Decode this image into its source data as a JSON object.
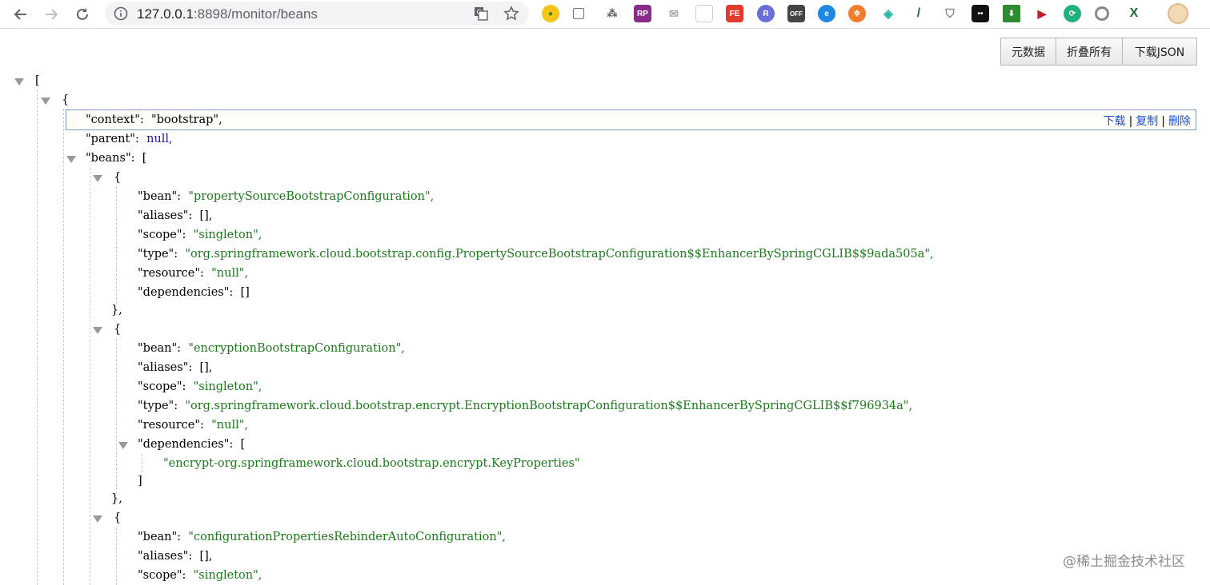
{
  "browser": {
    "url_host": "127.0.0.1",
    "url_rest": ":8898/monitor/beans",
    "extensions": [
      "tampermonkey-icon",
      "qr-icon",
      "sitemap-icon",
      "rp-icon",
      "mail-icon",
      "qr2-icon",
      "fe-icon",
      "r-icon",
      "off-icon",
      "edge-icon",
      "orange-icon",
      "vue-icon",
      "pen-icon",
      "shield-icon",
      "dots-icon",
      "download-icon",
      "video-icon",
      "refresh-icon",
      "circle-icon",
      "x-icon"
    ]
  },
  "toolbar": {
    "metadata_label": "元数据",
    "collapse_all_label": "折叠所有",
    "download_json_label": "下载JSON"
  },
  "highlight_actions": {
    "download": "下载",
    "copy": "复制",
    "delete": "删除",
    "sep": "|"
  },
  "tree": {
    "open_bracket": "[",
    "open_brace": "{",
    "context_key": "\"context\":",
    "context_val": "\"bootstrap\",",
    "parent_key": "\"parent\":",
    "parent_val": "null,",
    "beans_key": "\"beans\":",
    "beans_open": "[",
    "bean1": {
      "open": "{",
      "bean_key": "\"bean\":",
      "bean_val": "\"propertySourceBootstrapConfiguration\",",
      "aliases_key": "\"aliases\":",
      "aliases_val": "[],",
      "scope_key": "\"scope\":",
      "scope_val": "\"singleton\",",
      "type_key": "\"type\":",
      "type_val": "\"org.springframework.cloud.bootstrap.config.PropertySourceBootstrapConfiguration$$EnhancerBySpringCGLIB$$9ada505a\",",
      "resource_key": "\"resource\":",
      "resource_val": "\"null\",",
      "deps_key": "\"dependencies\":",
      "deps_val": "[]",
      "close": "},"
    },
    "bean2": {
      "open": "{",
      "bean_key": "\"bean\":",
      "bean_val": "\"encryptionBootstrapConfiguration\",",
      "aliases_key": "\"aliases\":",
      "aliases_val": "[],",
      "scope_key": "\"scope\":",
      "scope_val": "\"singleton\",",
      "type_key": "\"type\":",
      "type_val": "\"org.springframework.cloud.bootstrap.encrypt.EncryptionBootstrapConfiguration$$EnhancerBySpringCGLIB$$f796934a\",",
      "resource_key": "\"resource\":",
      "resource_val": "\"null\",",
      "deps_key": "\"dependencies\":",
      "deps_open": "[",
      "dep0": "\"encrypt-org.springframework.cloud.bootstrap.encrypt.KeyProperties\"",
      "deps_close": "]",
      "close": "},"
    },
    "bean3": {
      "open": "{",
      "bean_key": "\"bean\":",
      "bean_val": "\"configurationPropertiesRebinderAutoConfiguration\",",
      "aliases_key": "\"aliases\":",
      "aliases_val": "[],",
      "scope_key": "\"scope\":",
      "scope_val": "\"singleton\","
    }
  },
  "watermark": "@稀土掘金技术社区"
}
